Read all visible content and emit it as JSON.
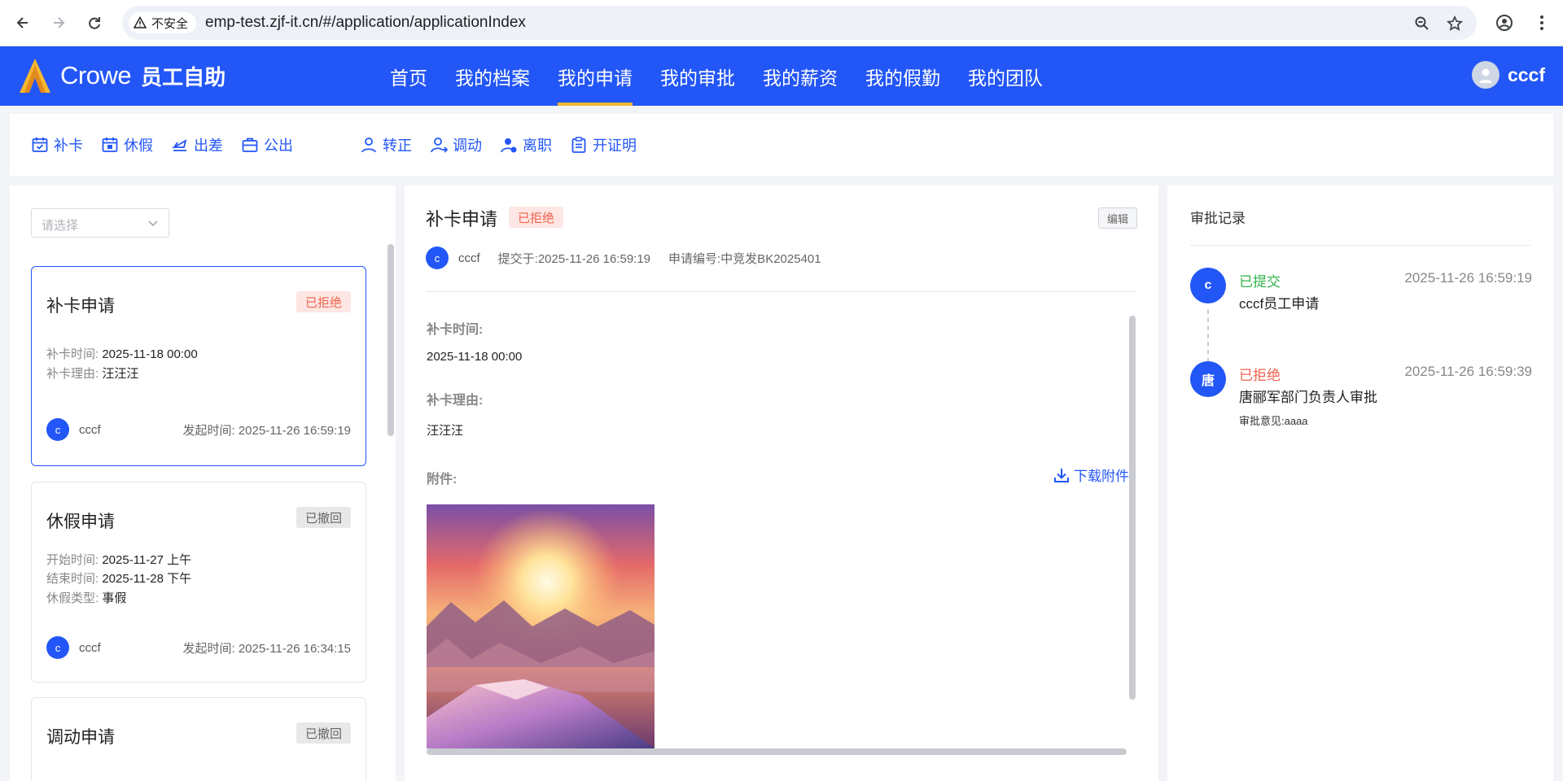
{
  "browser": {
    "security_label": "不安全",
    "url": "emp-test.zjf-it.cn/#/application/applicationIndex"
  },
  "header": {
    "brand": "Crowe",
    "subtitle": "员工自助",
    "nav": [
      "首页",
      "我的档案",
      "我的申请",
      "我的审批",
      "我的薪资",
      "我的假勤",
      "我的团队"
    ],
    "active_nav": "我的申请",
    "user_name": "cccf",
    "colors": {
      "primary": "#2356f6",
      "active_underline": "#f5b731"
    }
  },
  "actions": {
    "group1": [
      {
        "label": "补卡",
        "icon": "calendar-check-icon"
      },
      {
        "label": "休假",
        "icon": "calendar-leave-icon"
      },
      {
        "label": "出差",
        "icon": "plane-icon"
      },
      {
        "label": "公出",
        "icon": "briefcase-icon"
      }
    ],
    "group2": [
      {
        "label": "转正",
        "icon": "user-icon"
      },
      {
        "label": "调动",
        "icon": "user-transfer-icon"
      },
      {
        "label": "离职",
        "icon": "user-leave-icon"
      },
      {
        "label": "开证明",
        "icon": "clipboard-icon"
      }
    ]
  },
  "filter": {
    "placeholder": "请选择"
  },
  "cards": [
    {
      "title": "补卡申请",
      "status": "已拒绝",
      "fields": [
        {
          "label": "补卡时间:",
          "value": "2025-11-18 00:00"
        },
        {
          "label": "补卡理由:",
          "value": "汪汪汪"
        }
      ],
      "avatar": "c",
      "user": "cccf",
      "time_label": "发起时间:",
      "time": "2025-11-26 16:59:19"
    },
    {
      "title": "休假申请",
      "status": "已撤回",
      "fields": [
        {
          "label": "开始时间:",
          "value": "2025-11-27 上午"
        },
        {
          "label": "结束时间:",
          "value": "2025-11-28 下午"
        },
        {
          "label": "休假类型:",
          "value": "事假"
        }
      ],
      "avatar": "c",
      "user": "cccf",
      "time_label": "发起时间:",
      "time": "2025-11-26 16:34:15"
    },
    {
      "title": "调动申请",
      "status": "已撤回"
    }
  ],
  "detail": {
    "title": "补卡申请",
    "status": "已拒绝",
    "edit_label": "编辑",
    "avatar": "c",
    "user": "cccf",
    "submitted": "提交于:2025-11-26 16:59:19",
    "number": "申请编号:中竞发BK2025401",
    "time_label": "补卡时间:",
    "time_value": "2025-11-18 00:00",
    "reason_label": "补卡理由:",
    "reason_value": "汪汪汪",
    "attachment_label": "附件:",
    "download_label": "下载附件"
  },
  "approval": {
    "title": "审批记录",
    "records": [
      {
        "avatar": "c",
        "status": "已提交",
        "desc": "cccf员工申请",
        "time": "2025-11-26 16:59:19",
        "note": ""
      },
      {
        "avatar": "唐",
        "status": "已拒绝",
        "desc": "唐郦军部门负责人审批",
        "time": "2025-11-26 16:59:39",
        "note": "审批意见:aaaa"
      }
    ]
  }
}
